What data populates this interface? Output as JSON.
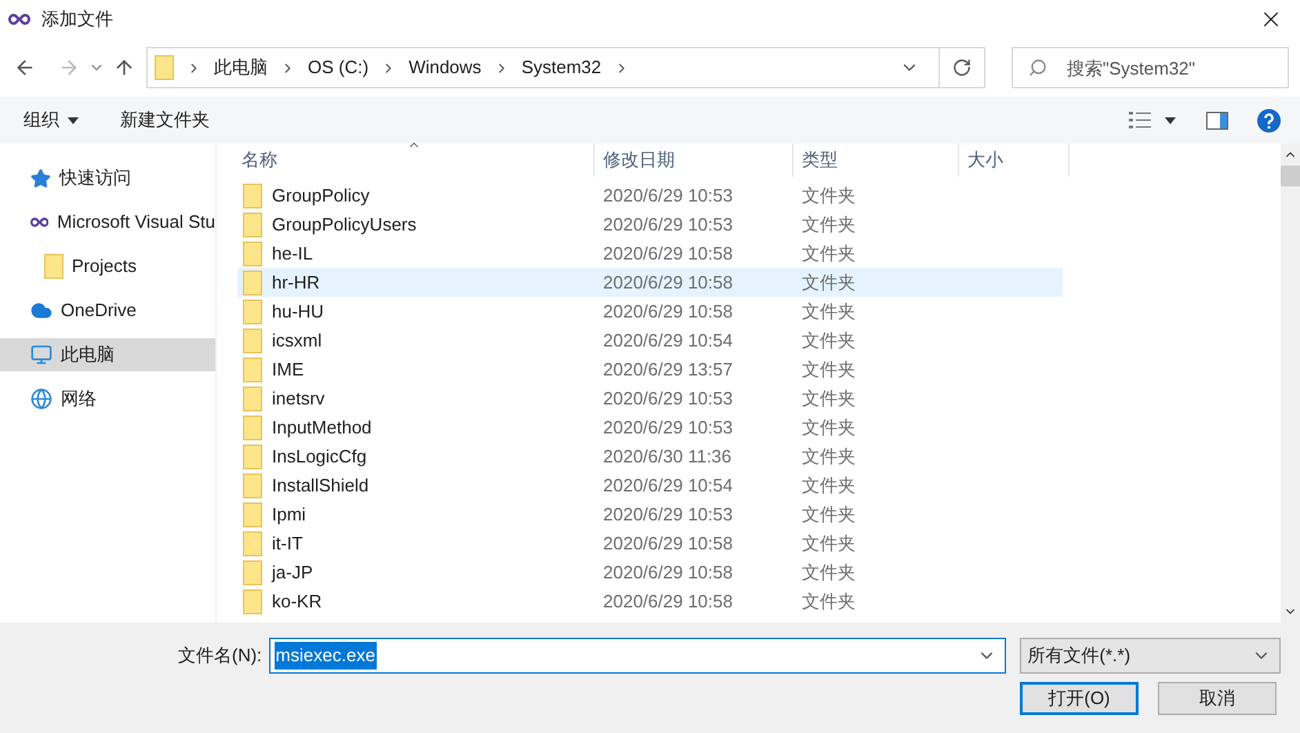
{
  "window": {
    "title": "添加文件"
  },
  "address": {
    "crumbs": [
      "此电脑",
      "OS (C:)",
      "Windows",
      "System32"
    ]
  },
  "search": {
    "placeholder": "搜索\"System32\""
  },
  "toolbar": {
    "organize": "组织",
    "new_folder": "新建文件夹"
  },
  "sidebar": {
    "items": [
      {
        "label": "快速访问",
        "kind": "star",
        "selected": false
      },
      {
        "label": "Microsoft Visual Stu",
        "kind": "vs",
        "selected": false,
        "children": [
          {
            "label": "Projects",
            "kind": "folder",
            "selected": false
          }
        ]
      },
      {
        "label": "OneDrive",
        "kind": "cloud",
        "selected": false
      },
      {
        "label": "此电脑",
        "kind": "pc",
        "selected": true
      },
      {
        "label": "网络",
        "kind": "network",
        "selected": false
      }
    ]
  },
  "table": {
    "columns": [
      "名称",
      "修改日期",
      "类型",
      "大小"
    ],
    "rows": [
      {
        "name": "GroupPolicy",
        "date": "2020/6/29 10:53",
        "type": "文件夹",
        "selected": false
      },
      {
        "name": "GroupPolicyUsers",
        "date": "2020/6/29 10:53",
        "type": "文件夹",
        "selected": false
      },
      {
        "name": "he-IL",
        "date": "2020/6/29 10:58",
        "type": "文件夹",
        "selected": false
      },
      {
        "name": "hr-HR",
        "date": "2020/6/29 10:58",
        "type": "文件夹",
        "selected": true
      },
      {
        "name": "hu-HU",
        "date": "2020/6/29 10:58",
        "type": "文件夹",
        "selected": false
      },
      {
        "name": "icsxml",
        "date": "2020/6/29 10:54",
        "type": "文件夹",
        "selected": false
      },
      {
        "name": "IME",
        "date": "2020/6/29 13:57",
        "type": "文件夹",
        "selected": false
      },
      {
        "name": "inetsrv",
        "date": "2020/6/29 10:53",
        "type": "文件夹",
        "selected": false
      },
      {
        "name": "InputMethod",
        "date": "2020/6/29 10:53",
        "type": "文件夹",
        "selected": false
      },
      {
        "name": "InsLogicCfg",
        "date": "2020/6/30 11:36",
        "type": "文件夹",
        "selected": false
      },
      {
        "name": "InstallShield",
        "date": "2020/6/29 10:54",
        "type": "文件夹",
        "selected": false
      },
      {
        "name": "Ipmi",
        "date": "2020/6/29 10:53",
        "type": "文件夹",
        "selected": false
      },
      {
        "name": "it-IT",
        "date": "2020/6/29 10:58",
        "type": "文件夹",
        "selected": false
      },
      {
        "name": "ja-JP",
        "date": "2020/6/29 10:58",
        "type": "文件夹",
        "selected": false
      },
      {
        "name": "ko-KR",
        "date": "2020/6/29 10:58",
        "type": "文件夹",
        "selected": false
      }
    ]
  },
  "footer": {
    "filename_label": "文件名(N):",
    "filename": "msiexec.exe",
    "filter": "所有文件(*.*)",
    "buttons": [
      "打开(O)",
      "取消"
    ]
  }
}
